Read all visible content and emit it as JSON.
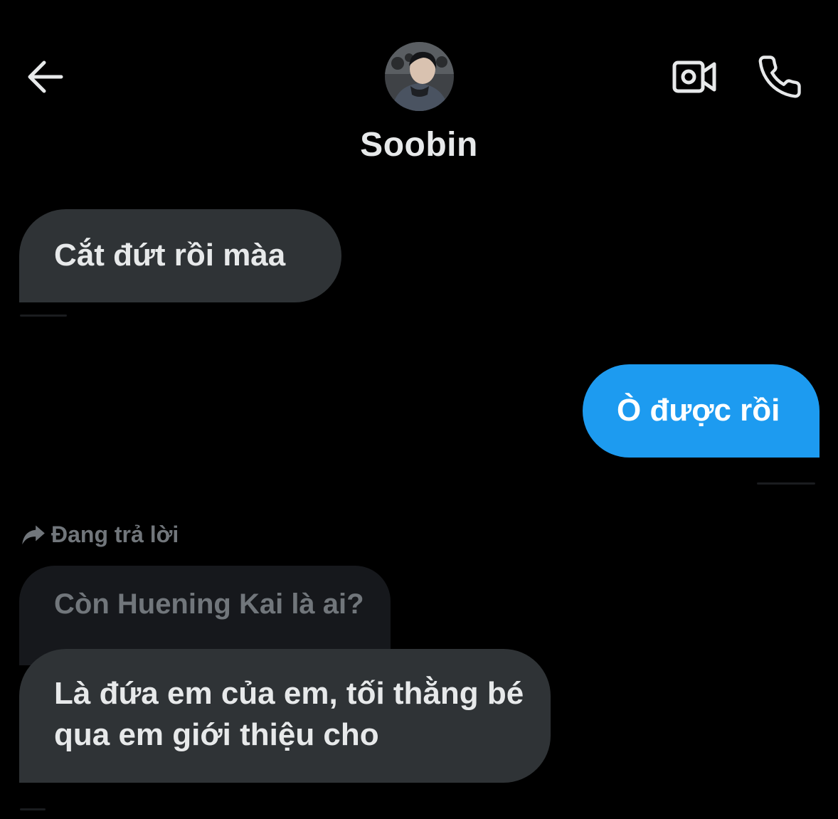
{
  "header": {
    "contact_name": "Soobin",
    "back_icon": "back-arrow-icon",
    "video_icon": "video-camera-icon",
    "phone_icon": "phone-icon"
  },
  "messages": [
    {
      "direction": "incoming",
      "text": "Cắt đứt rồi màa"
    },
    {
      "direction": "outgoing",
      "text": "Ò được rồi"
    },
    {
      "direction": "incoming",
      "reply_label": "Đang trả lời",
      "quoted_text": "Còn Huening Kai là ai?",
      "text": "Là đứa em của em, tối thằng bé qua em giới thiệu cho"
    }
  ],
  "colors": {
    "background": "#000000",
    "incoming_bubble": "#2f3336",
    "outgoing_bubble": "#1d9bf0",
    "quoted_bubble": "#16181c",
    "muted_text": "#71767b",
    "primary_text": "#e7e9ea"
  }
}
